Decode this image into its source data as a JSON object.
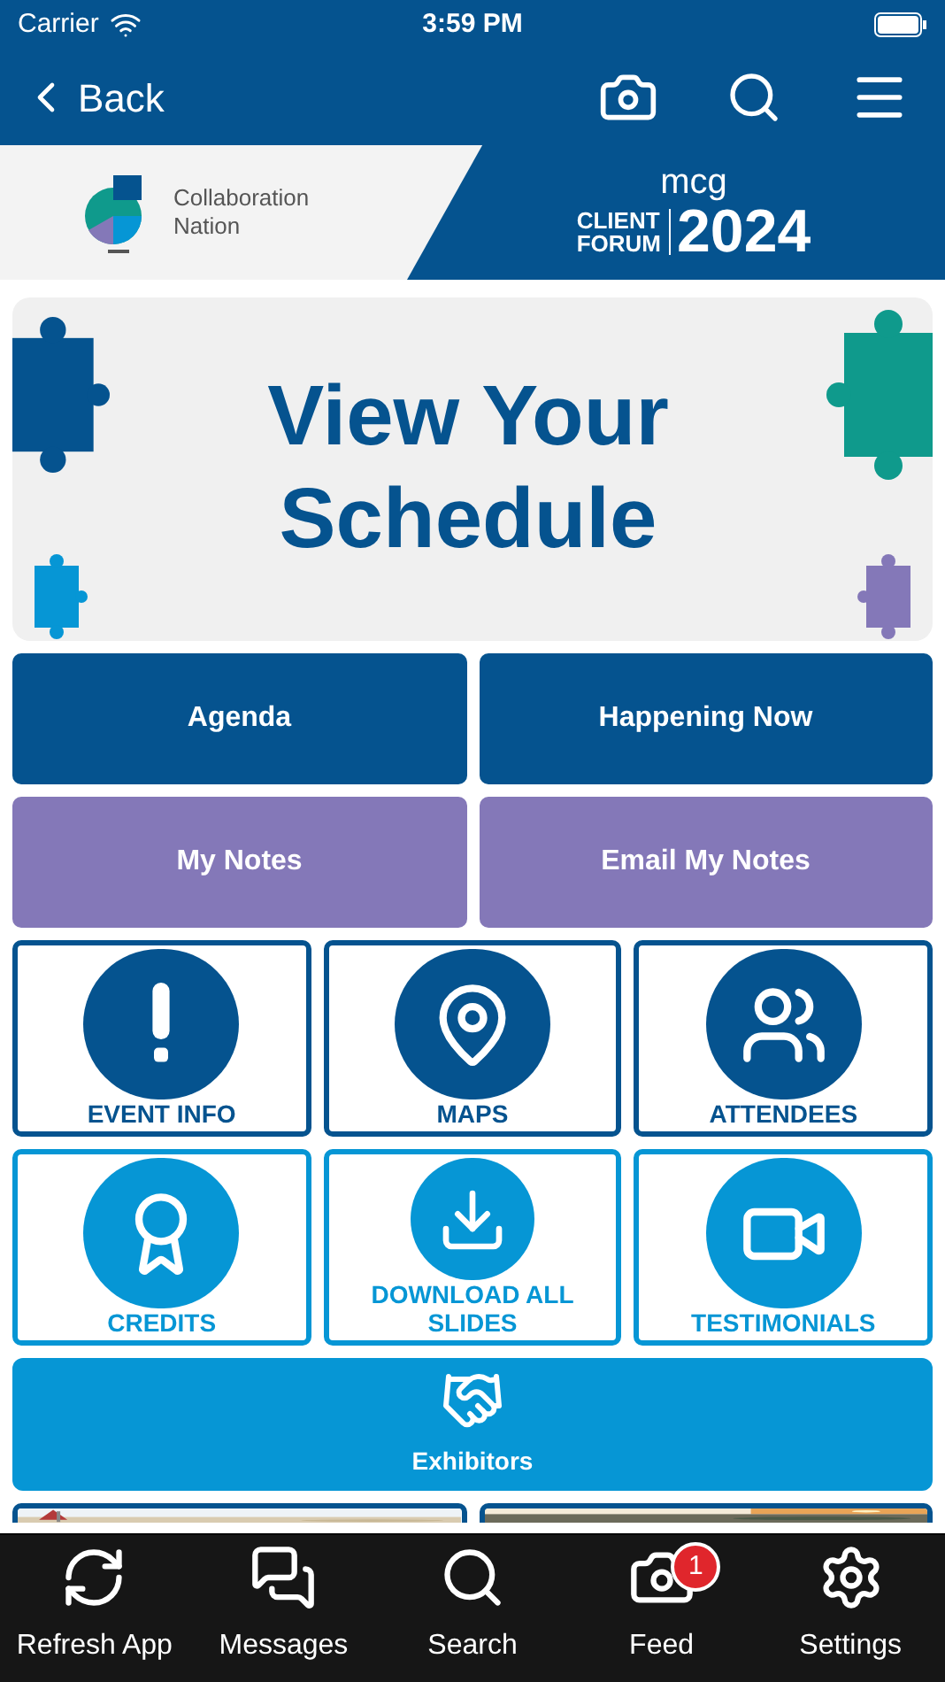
{
  "status_bar": {
    "carrier": "Carrier",
    "time": "3:59 PM"
  },
  "nav": {
    "back": "Back"
  },
  "banner": {
    "org_line1": "Collaboration",
    "org_line2": "Nation",
    "brand": "mcg",
    "event_line1": "CLIENT",
    "event_line2": "FORUM",
    "year": "2024"
  },
  "hero": {
    "title_line1": "View Your",
    "title_line2": "Schedule"
  },
  "buttons": [
    {
      "label": "Agenda",
      "color": "#05538f"
    },
    {
      "label": "Happening Now",
      "color": "#05538f"
    },
    {
      "label": "My Notes",
      "color": "#8478b8"
    },
    {
      "label": "Email My Notes",
      "color": "#8478b8"
    }
  ],
  "tiles": [
    {
      "label": "EVENT INFO",
      "color": "#05538f"
    },
    {
      "label": "MAPS",
      "color": "#05538f"
    },
    {
      "label": "ATTENDEES",
      "color": "#05538f"
    },
    {
      "label": "CREDITS",
      "color": "#0696d5"
    },
    {
      "label": "DOWNLOAD ALL SLIDES",
      "color": "#0696d5"
    },
    {
      "label": "TESTIMONIALS",
      "color": "#0696d5"
    }
  ],
  "exhibitors": {
    "label": "Exhibitors"
  },
  "tab_bar": [
    {
      "label": "Refresh App"
    },
    {
      "label": "Messages"
    },
    {
      "label": "Search"
    },
    {
      "label": "Feed",
      "badge": "1"
    },
    {
      "label": "Settings"
    }
  ]
}
